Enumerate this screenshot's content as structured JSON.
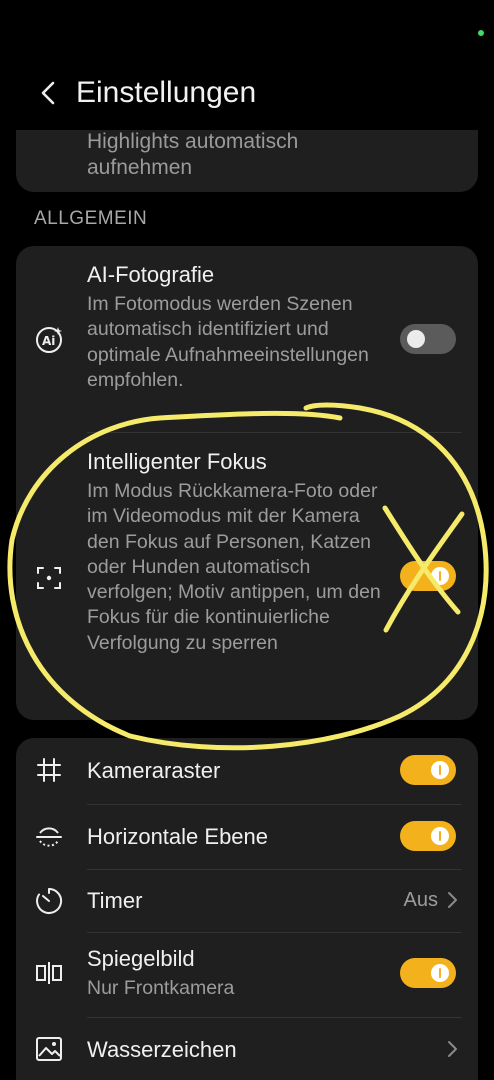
{
  "header": {
    "title": "Einstellungen"
  },
  "top_card": {
    "text": "Highlights automatisch aufnehmen"
  },
  "section": {
    "label": "ALLGEMEIN"
  },
  "general": {
    "ai_photo": {
      "title": "AI-Fotografie",
      "description": "Im Fotomodus werden Szenen automatisch identifiziert und optimale Aufnahmeeinstellungen empfohlen.",
      "enabled": false
    },
    "smart_focus": {
      "title": "Intelligenter Fokus",
      "description": "Im Modus Rückkamera-Foto oder im Videomodus mit der Kamera den Fokus auf Personen, Katzen oder Hunden automatisch verfolgen; Motiv antippen, um den Fokus für die kontinuierliche Verfolgung zu sperren",
      "enabled": true
    }
  },
  "misc": {
    "grid": {
      "title": "Kameraraster",
      "enabled": true
    },
    "level": {
      "title": "Horizontale Ebene",
      "enabled": true
    },
    "timer": {
      "title": "Timer",
      "value": "Aus"
    },
    "mirror": {
      "title": "Spiegelbild",
      "subtitle": "Nur Frontkamera",
      "enabled": true
    },
    "watermark": {
      "title": "Wasserzeichen"
    }
  },
  "colors": {
    "accent": "#f3b21b",
    "card": "#1f1f1f",
    "annotation": "#f5ea6a"
  }
}
